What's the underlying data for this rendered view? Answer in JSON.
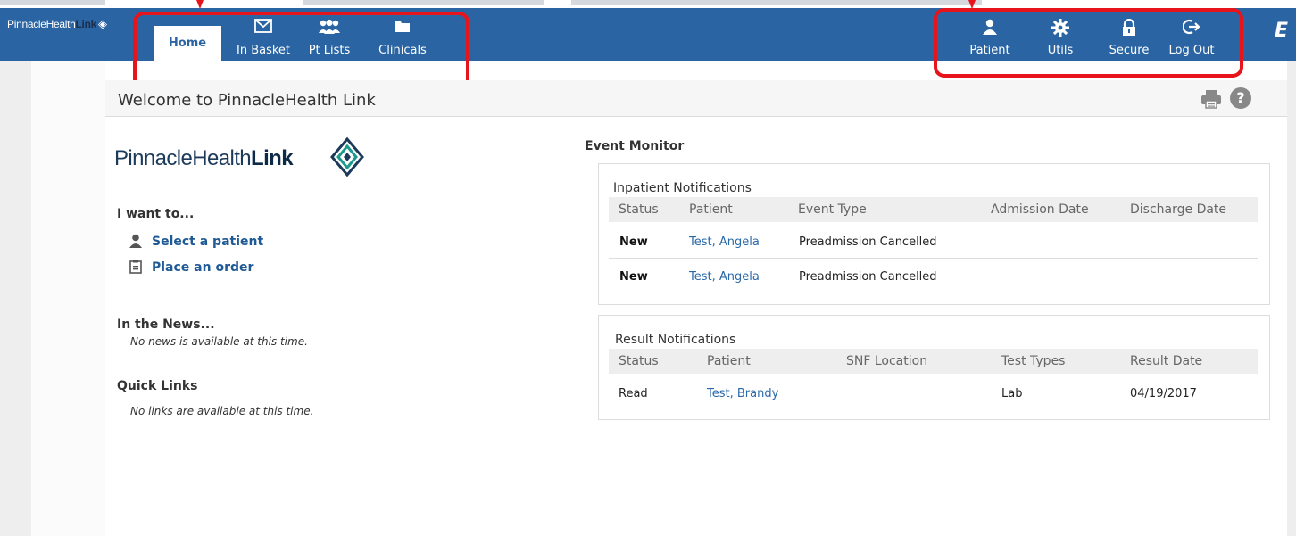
{
  "nav": {
    "brand_text": "PinnacleHealth",
    "brand_link": "Link",
    "brand_diamond": "◈",
    "home": "Home",
    "items": [
      {
        "label": "In Basket",
        "icon": "envelope-icon"
      },
      {
        "label": "Pt Lists",
        "icon": "people-icon"
      },
      {
        "label": "Clinicals",
        "icon": "folder-icon"
      }
    ],
    "right_items": [
      {
        "label": "Patient",
        "icon": "person-icon"
      },
      {
        "label": "Utils",
        "icon": "gear-icon"
      },
      {
        "label": "Secure",
        "icon": "lock-icon"
      },
      {
        "label": "Log Out",
        "icon": "logout-icon"
      }
    ],
    "edge_text": "E"
  },
  "panel": {
    "title": "Welcome to PinnacleHealth Link",
    "help_label": "?"
  },
  "logo": {
    "text_light": "PinnacleHealth",
    "text_bold": "Link"
  },
  "left": {
    "want_heading": "I want to...",
    "actions": [
      "Select a patient",
      "Place an order"
    ],
    "news_heading": "In the News...",
    "news_text": "No news is available at this time.",
    "links_heading": "Quick Links",
    "links_text": "No links are available at this time."
  },
  "event_monitor": {
    "title": "Event Monitor",
    "inpatient": {
      "title": "Inpatient Notifications",
      "columns": [
        "Status",
        "Patient",
        "Event Type",
        "Admission Date",
        "Discharge Date"
      ],
      "rows": [
        {
          "status": "New",
          "patient": "Test, Angela",
          "event_type": "Preadmission Cancelled",
          "admission": "",
          "discharge": ""
        },
        {
          "status": "New",
          "patient": "Test, Angela",
          "event_type": "Preadmission Cancelled",
          "admission": "",
          "discharge": ""
        }
      ]
    },
    "result": {
      "title": "Result Notifications",
      "columns": [
        "Status",
        "Patient",
        "SNF Location",
        "Test Types",
        "Result Date"
      ],
      "rows": [
        {
          "status": "Read",
          "patient": "Test, Brandy",
          "snf": "",
          "test_types": "Lab",
          "result_date": "04/19/2017"
        }
      ]
    }
  },
  "colors": {
    "nav_bg": "#2a64a2",
    "link": "#2a68a8",
    "highlight_box": "#e8141c"
  }
}
